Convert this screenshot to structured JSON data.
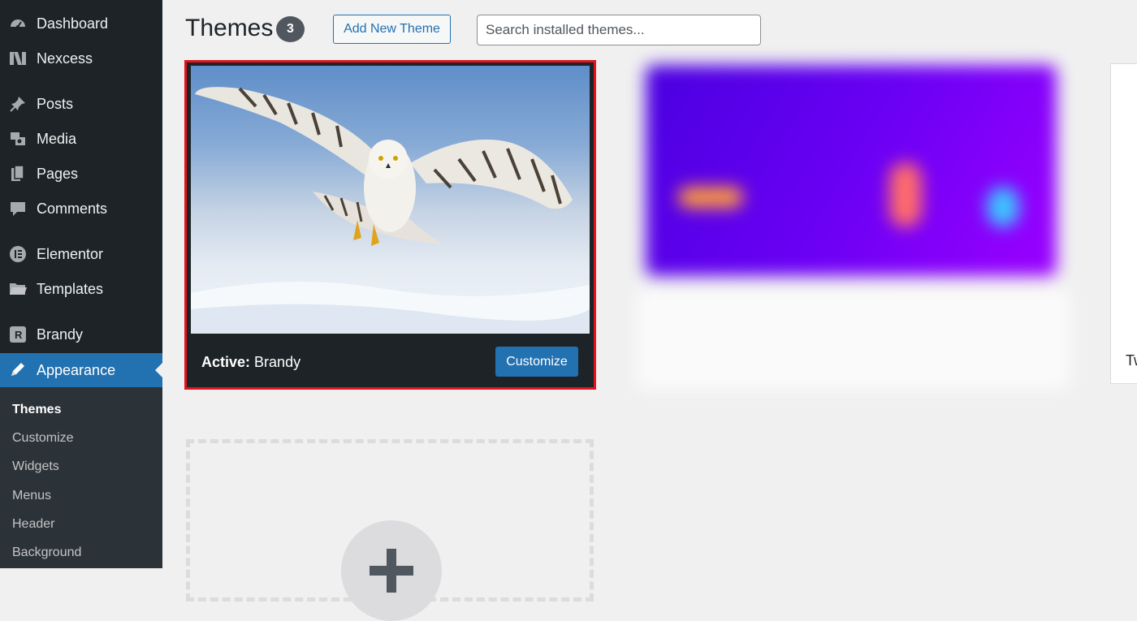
{
  "sidebar": {
    "items": [
      {
        "label": "Dashboard",
        "icon": "dashboard-icon"
      },
      {
        "label": "Nexcess",
        "icon": "nexcess-icon"
      },
      {
        "label": "Posts",
        "icon": "pin-icon"
      },
      {
        "label": "Media",
        "icon": "media-icon"
      },
      {
        "label": "Pages",
        "icon": "pages-icon"
      },
      {
        "label": "Comments",
        "icon": "comments-icon"
      },
      {
        "label": "Elementor",
        "icon": "elementor-icon"
      },
      {
        "label": "Templates",
        "icon": "folder-icon"
      },
      {
        "label": "Brandy",
        "icon": "brandy-icon"
      },
      {
        "label": "Appearance",
        "icon": "appearance-icon",
        "current": true
      }
    ],
    "submenu": [
      "Themes",
      "Customize",
      "Widgets",
      "Menus",
      "Header",
      "Background"
    ]
  },
  "header": {
    "title": "Themes",
    "count": "3",
    "add_new_label": "Add New Theme",
    "search_placeholder": "Search installed themes..."
  },
  "active_theme": {
    "active_prefix": "Active:",
    "name": "Brandy",
    "customize_label": "Customize"
  },
  "third_theme": {
    "name_partial": "Tw"
  },
  "colors": {
    "sidebar": "#1d2327",
    "accent": "#2271b1",
    "highlight_border": "#e3141b"
  }
}
